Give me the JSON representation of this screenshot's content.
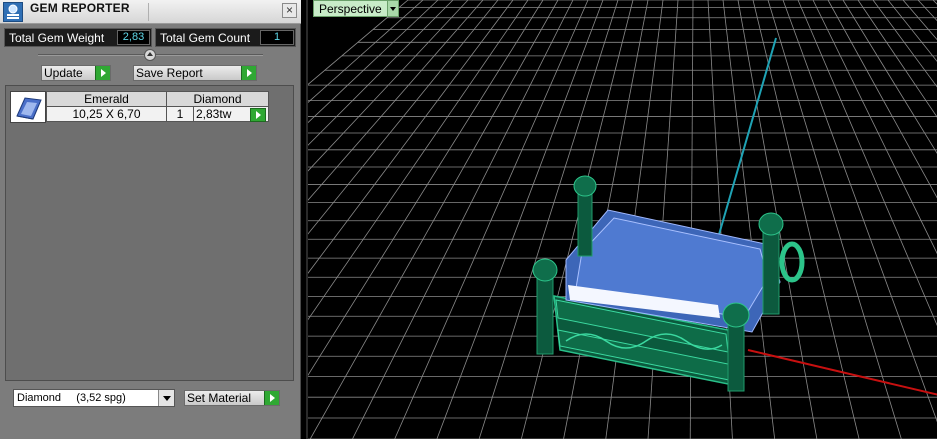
{
  "panel": {
    "title": "GEM REPORTER",
    "close_label": "×",
    "total_weight_label": "Total Gem Weight",
    "total_weight_value": "2,83",
    "total_count_label": "Total Gem Count",
    "total_count_value": "1",
    "update_label": "Update",
    "save_report_label": "Save Report",
    "table": {
      "headers": [
        "Emerald",
        "Diamond"
      ],
      "size": "10,25 X 6,70",
      "count": "1",
      "weight": "2,83tw"
    },
    "material_select": "Diamond     (3,52 spg)",
    "set_material_label": "Set Material"
  },
  "viewport": {
    "view_label": "Perspective"
  },
  "colors": {
    "grid": "#8a8a8a",
    "y_axis": "#1fa3b5",
    "x_axis": "#c81010",
    "gem_blue": "#3d66b8",
    "setting_green": "#0f6b4a",
    "accent_green": "#2fa833"
  },
  "icons": [
    "gem-reporter-icon",
    "close-icon",
    "play-arrow-icon",
    "dropdown-caret-icon",
    "gem-thumbnail-icon"
  ]
}
